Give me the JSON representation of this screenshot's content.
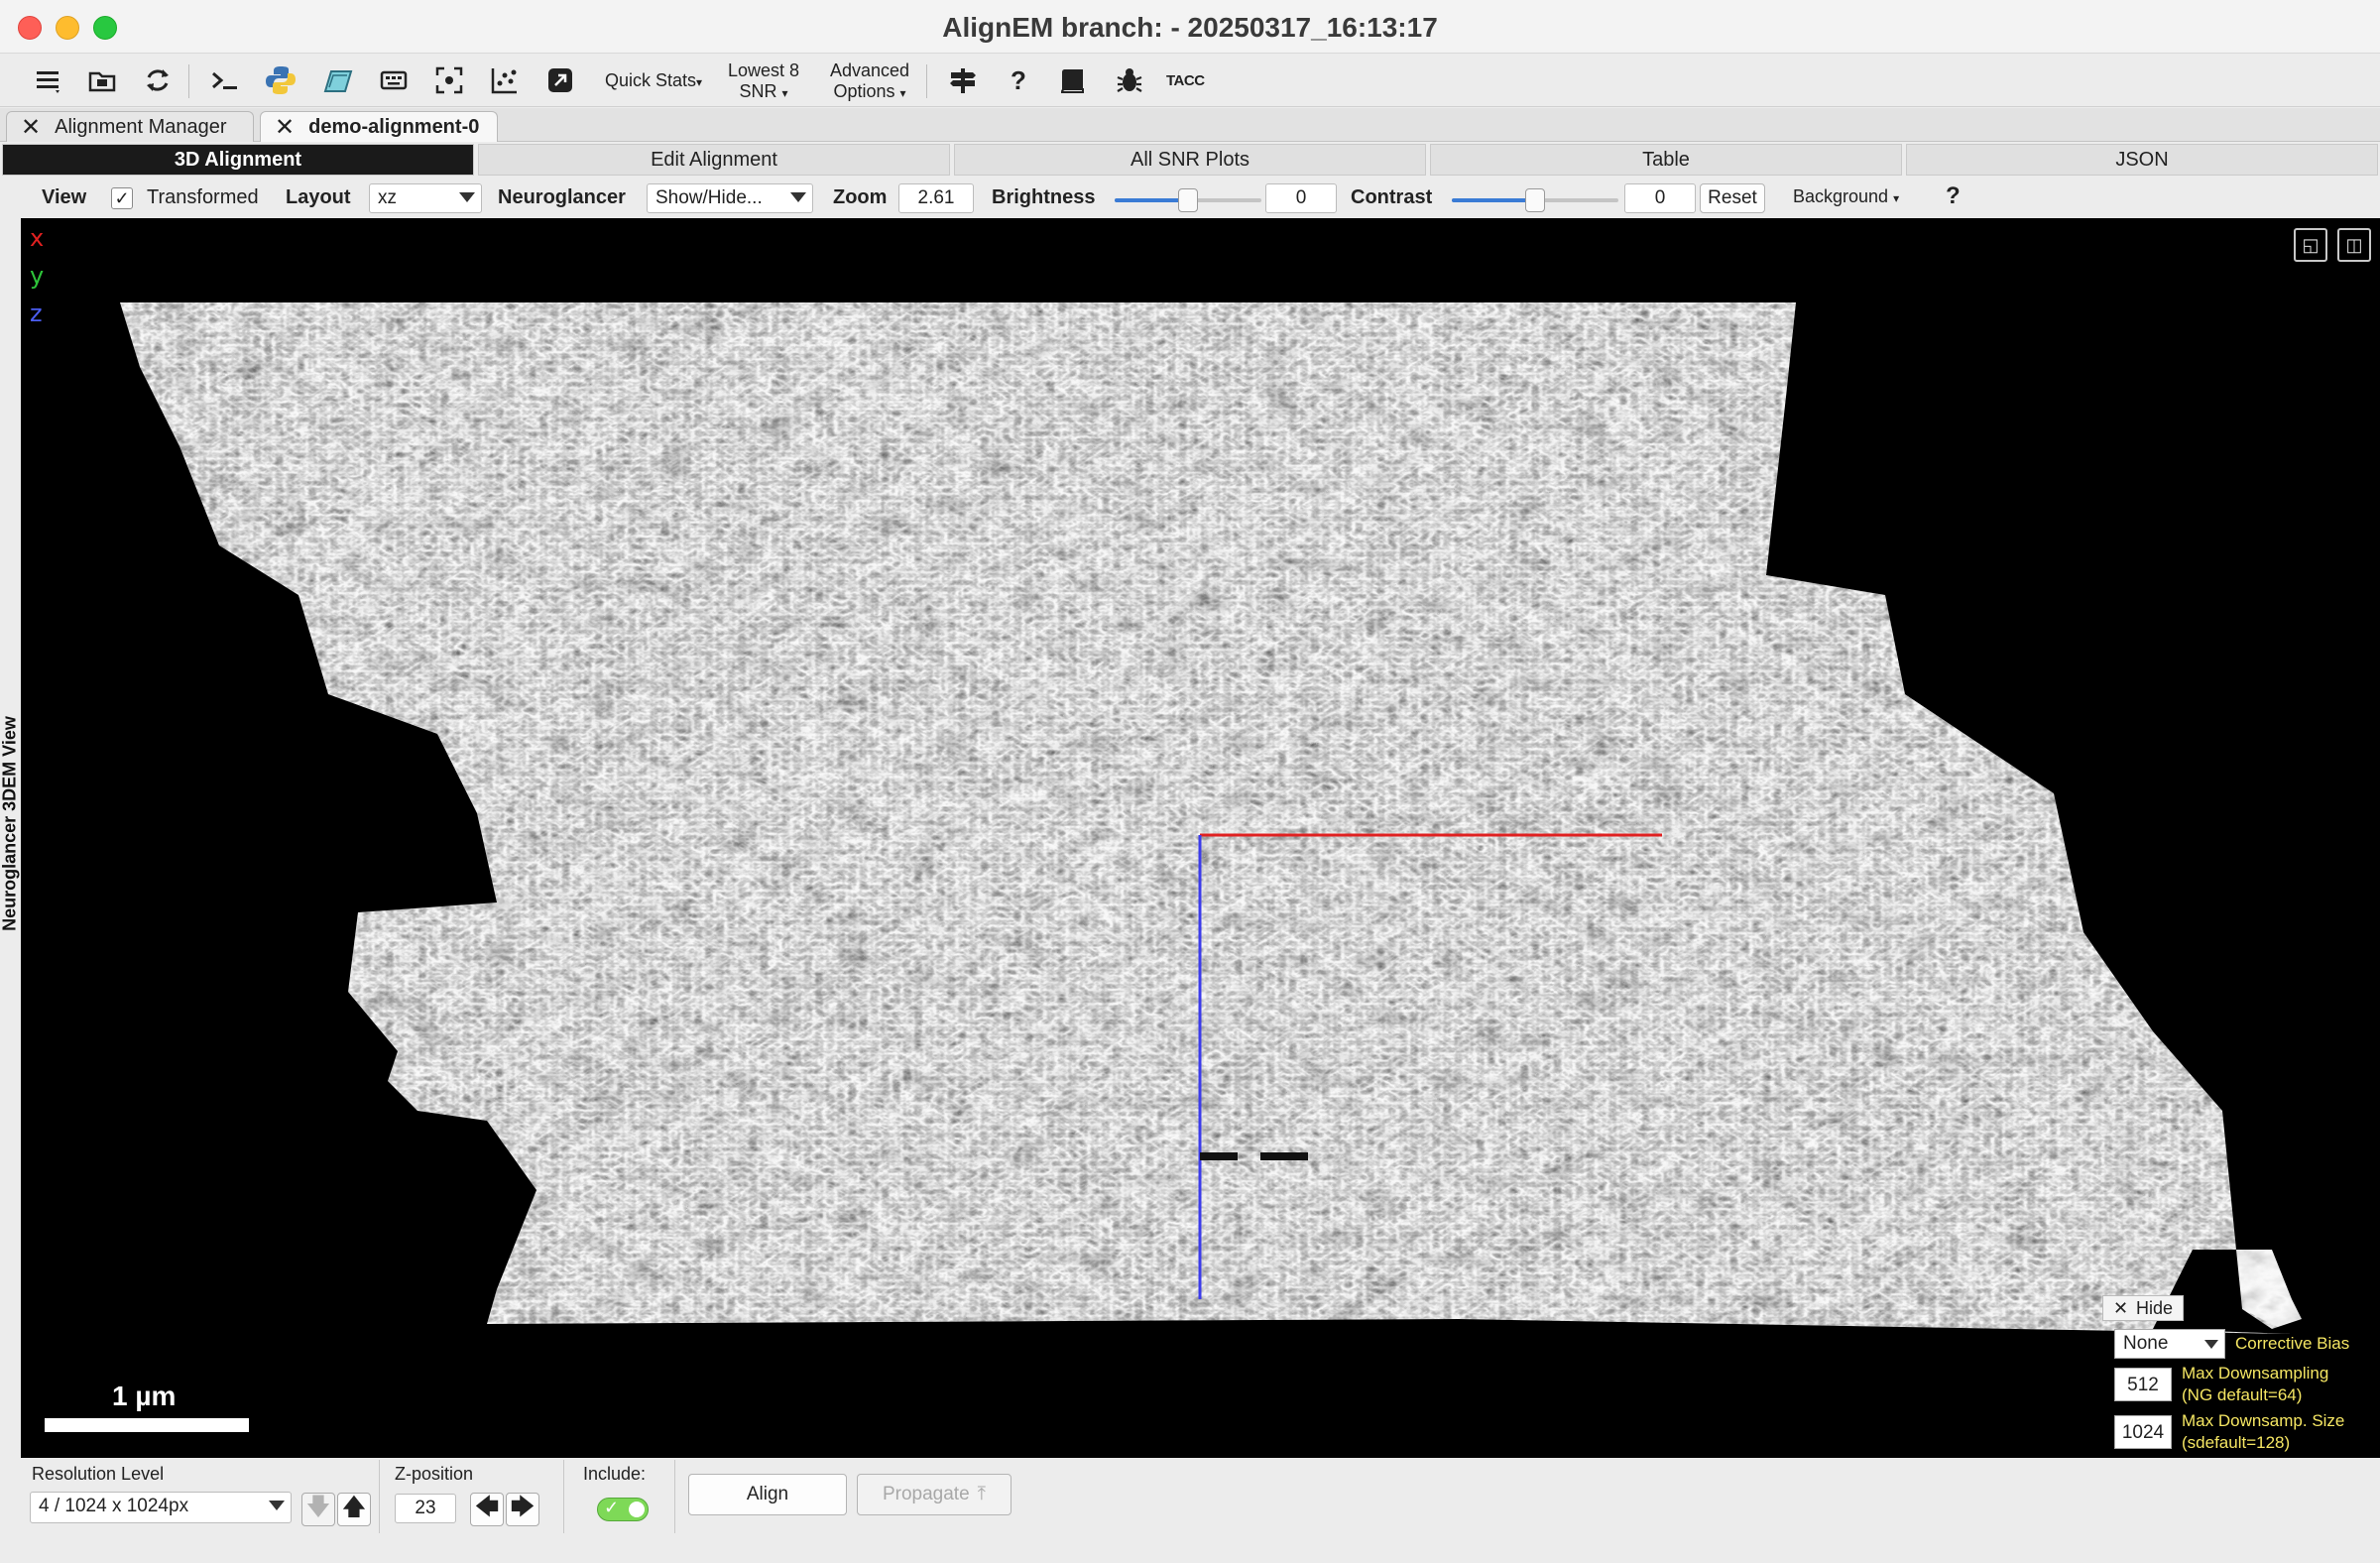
{
  "window": {
    "title": "AlignEM branch:  - 20250317_16:13:17"
  },
  "toolbar": {
    "icons": [
      "menu-icon",
      "folder-icon",
      "refresh-icon",
      "terminal-icon",
      "python-icon",
      "notebook-icon",
      "keyboard-icon",
      "focus-icon",
      "scatter-chart-icon",
      "external-link-icon"
    ],
    "quick_stats": "Quick Stats",
    "lowest_snr_line1": "Lowest 8",
    "lowest_snr_line2": "SNR",
    "advanced_line1": "Advanced",
    "advanced_line2": "Options",
    "right_icons": [
      "signpost-icon",
      "help-icon",
      "book-icon",
      "bug-icon"
    ],
    "tacc": "TACC"
  },
  "doc_tabs": [
    {
      "label": "Alignment Manager",
      "active": false
    },
    {
      "label": "demo-alignment-0",
      "active": true
    }
  ],
  "sub_tabs": [
    {
      "label": "3D Alignment",
      "active": true
    },
    {
      "label": "Edit Alignment",
      "active": false
    },
    {
      "label": "All SNR Plots",
      "active": false
    },
    {
      "label": "Table",
      "active": false
    },
    {
      "label": "JSON",
      "active": false
    }
  ],
  "controls": {
    "view_label": "View",
    "transformed_checked": true,
    "transformed_label": "Transformed",
    "layout_label": "Layout",
    "layout_value": "xz",
    "neuroglancer_label": "Neuroglancer",
    "neuroglancer_value": "Show/Hide...",
    "zoom_label": "Zoom",
    "zoom_value": "2.61",
    "brightness_label": "Brightness",
    "brightness_value": "0",
    "brightness_fraction": 0.5,
    "contrast_label": "Contrast",
    "contrast_value": "0",
    "contrast_fraction": 0.5,
    "reset_label": "Reset",
    "background_label": "Background",
    "help_glyph": "?"
  },
  "viewer": {
    "side_label": "Neuroglancer 3DEM View",
    "axes": [
      {
        "label": "x",
        "color": "#e02020"
      },
      {
        "label": "y",
        "color": "#2ec43a"
      },
      {
        "label": "z",
        "color": "#4b5df2"
      }
    ],
    "scale_bar_label": "1 µm",
    "overlay": {
      "hide_label": "Hide",
      "bias_value": "None",
      "bias_label": "Corrective Bias",
      "max_downsampling_value": "512",
      "max_downsampling_line1": "Max Downsampling",
      "max_downsampling_line2": "(NG default=64)",
      "max_downsamp_size_value": "1024",
      "max_downsamp_size_line1": "Max Downsamp. Size",
      "max_downsamp_size_line2": "(sdefault=128)"
    }
  },
  "bottom": {
    "resolution_label": "Resolution Level",
    "resolution_value": "4 / 1024 x 1024px",
    "zpos_label": "Z-position",
    "zpos_value": "23",
    "include_label": "Include:",
    "include_on": true,
    "align_label": "Align",
    "propagate_label": "Propagate"
  }
}
